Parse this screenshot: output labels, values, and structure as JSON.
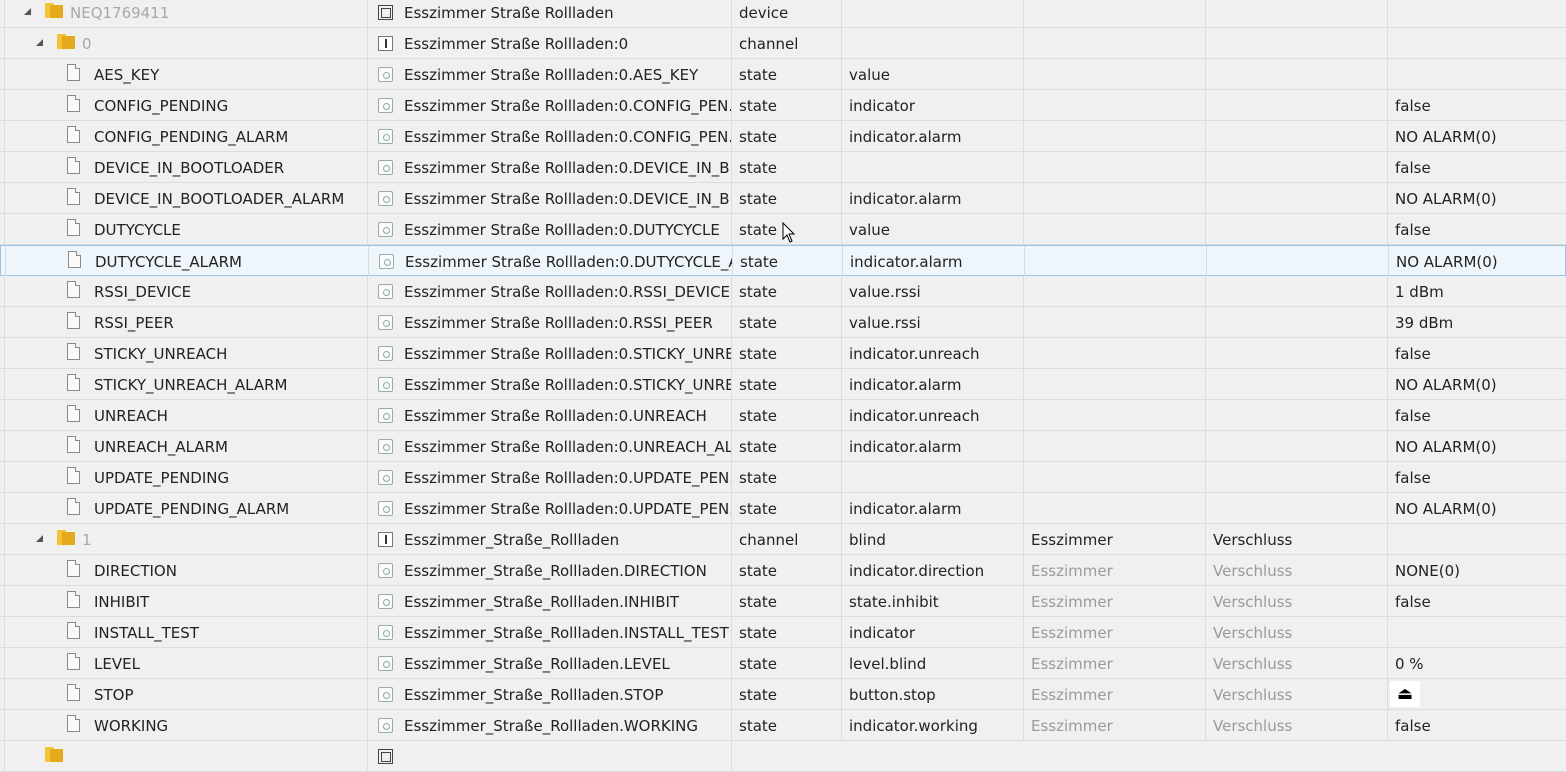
{
  "device_row": {
    "name": "NEQ1769411",
    "id": "Esszimmer Straße Rollladen",
    "type": "device"
  },
  "channel0": {
    "name": "0",
    "id": "Esszimmer Straße Rollladen:0",
    "type": "channel",
    "states": [
      {
        "name": "AES_KEY",
        "id": "Esszimmer Straße Rollladen:0.AES_KEY",
        "type": "state",
        "role": "value",
        "value": ""
      },
      {
        "name": "CONFIG_PENDING",
        "id": "Esszimmer Straße Rollladen:0.CONFIG_PEN...",
        "type": "state",
        "role": "indicator",
        "value": "false"
      },
      {
        "name": "CONFIG_PENDING_ALARM",
        "id": "Esszimmer Straße Rollladen:0.CONFIG_PEN...",
        "type": "state",
        "role": "indicator.alarm",
        "value": "NO ALARM(0)"
      },
      {
        "name": "DEVICE_IN_BOOTLOADER",
        "id": "Esszimmer Straße Rollladen:0.DEVICE_IN_B...",
        "type": "state",
        "role": "",
        "value": "false"
      },
      {
        "name": "DEVICE_IN_BOOTLOADER_ALARM",
        "id": "Esszimmer Straße Rollladen:0.DEVICE_IN_B...",
        "type": "state",
        "role": "indicator.alarm",
        "value": "NO ALARM(0)"
      },
      {
        "name": "DUTYCYCLE",
        "id": "Esszimmer Straße Rollladen:0.DUTYCYCLE",
        "type": "state",
        "role": "value",
        "value": "false"
      },
      {
        "name": "DUTYCYCLE_ALARM",
        "id": "Esszimmer Straße Rollladen:0.DUTYCYCLE_A...",
        "type": "state",
        "role": "indicator.alarm",
        "value": "NO ALARM(0)",
        "selected": true
      },
      {
        "name": "RSSI_DEVICE",
        "id": "Esszimmer Straße Rollladen:0.RSSI_DEVICE",
        "type": "state",
        "role": "value.rssi",
        "value": "1 dBm"
      },
      {
        "name": "RSSI_PEER",
        "id": "Esszimmer Straße Rollladen:0.RSSI_PEER",
        "type": "state",
        "role": "value.rssi",
        "value": "39 dBm"
      },
      {
        "name": "STICKY_UNREACH",
        "id": "Esszimmer Straße Rollladen:0.STICKY_UNRE...",
        "type": "state",
        "role": "indicator.unreach",
        "value": "false"
      },
      {
        "name": "STICKY_UNREACH_ALARM",
        "id": "Esszimmer Straße Rollladen:0.STICKY_UNRE...",
        "type": "state",
        "role": "indicator.alarm",
        "value": "NO ALARM(0)"
      },
      {
        "name": "UNREACH",
        "id": "Esszimmer Straße Rollladen:0.UNREACH",
        "type": "state",
        "role": "indicator.unreach",
        "value": "false"
      },
      {
        "name": "UNREACH_ALARM",
        "id": "Esszimmer Straße Rollladen:0.UNREACH_AL...",
        "type": "state",
        "role": "indicator.alarm",
        "value": "NO ALARM(0)"
      },
      {
        "name": "UPDATE_PENDING",
        "id": "Esszimmer Straße Rollladen:0.UPDATE_PEN...",
        "type": "state",
        "role": "",
        "value": "false"
      },
      {
        "name": "UPDATE_PENDING_ALARM",
        "id": "Esszimmer Straße Rollladen:0.UPDATE_PEN...",
        "type": "state",
        "role": "indicator.alarm",
        "value": "NO ALARM(0)"
      }
    ]
  },
  "channel1": {
    "name": "1",
    "id": "Esszimmer_Straße_Rollladen",
    "type": "channel",
    "role": "blind",
    "room": "Esszimmer",
    "function": "Verschluss",
    "states": [
      {
        "name": "DIRECTION",
        "id": "Esszimmer_Straße_Rollladen.DIRECTION",
        "type": "state",
        "role": "indicator.direction",
        "room": "Esszimmer",
        "function": "Verschluss",
        "value": "NONE(0)"
      },
      {
        "name": "INHIBIT",
        "id": "Esszimmer_Straße_Rollladen.INHIBIT",
        "type": "state",
        "role": "state.inhibit",
        "room": "Esszimmer",
        "function": "Verschluss",
        "value": "false"
      },
      {
        "name": "INSTALL_TEST",
        "id": "Esszimmer_Straße_Rollladen.INSTALL_TEST",
        "type": "state",
        "role": "indicator",
        "room": "Esszimmer",
        "function": "Verschluss",
        "value": ""
      },
      {
        "name": "LEVEL",
        "id": "Esszimmer_Straße_Rollladen.LEVEL",
        "type": "state",
        "role": "level.blind",
        "room": "Esszimmer",
        "function": "Verschluss",
        "value": "0 %"
      },
      {
        "name": "STOP",
        "id": "Esszimmer_Straße_Rollladen.STOP",
        "type": "state",
        "role": "button.stop",
        "room": "Esszimmer",
        "function": "Verschluss",
        "value": "⏏",
        "is_button": true
      },
      {
        "name": "WORKING",
        "id": "Esszimmer_Straße_Rollladen.WORKING",
        "type": "state",
        "role": "indicator.working",
        "room": "Esszimmer",
        "function": "Verschluss",
        "value": "false"
      }
    ]
  },
  "icons": {
    "folder": "folder-icon",
    "file": "file-icon",
    "device": "device-icon",
    "channel": "channel-icon",
    "state": "state-icon",
    "stop_button": "eject-icon"
  },
  "colors": {
    "selected_row_bg": "#eef5fb",
    "selected_row_border": "#9cc3e3",
    "folder": "#f3c338",
    "muted_text": "#9a9a9a"
  }
}
